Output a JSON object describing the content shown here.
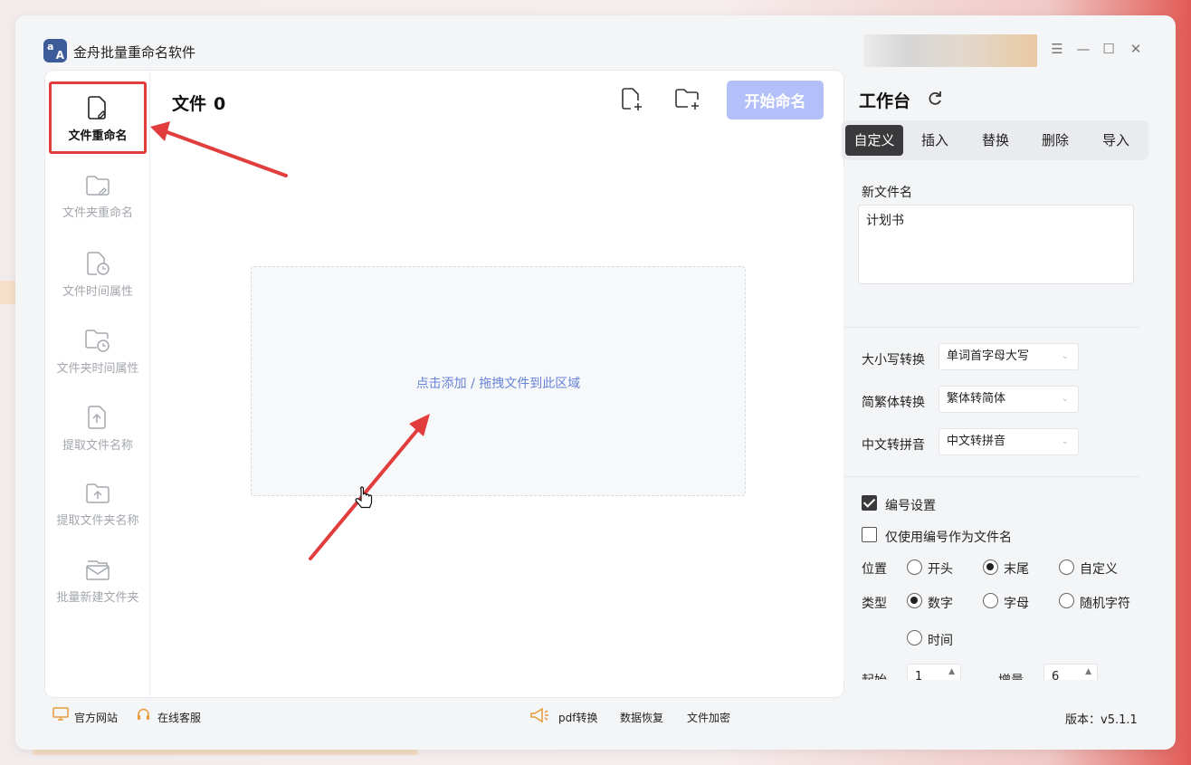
{
  "app": {
    "title": "金舟批量重命名软件",
    "logo_a": "a",
    "logo_b": "A"
  },
  "window_controls": {
    "menu": "☰",
    "minimize": "—",
    "maximize": "☐",
    "close": "✕"
  },
  "sidebar": {
    "items": [
      {
        "label": "文件重命名",
        "icon": "file-edit-icon"
      },
      {
        "label": "文件夹重命名",
        "icon": "folder-edit-icon"
      },
      {
        "label": "文件时间属性",
        "icon": "file-clock-icon"
      },
      {
        "label": "文件夹时间属性",
        "icon": "folder-clock-icon"
      },
      {
        "label": "提取文件名称",
        "icon": "file-upload-icon"
      },
      {
        "label": "提取文件夹名称",
        "icon": "folder-upload-icon"
      },
      {
        "label": "批量新建文件夹",
        "icon": "folder-mail-icon"
      }
    ]
  },
  "files": {
    "label": "文件",
    "count": "0"
  },
  "toolbar": {
    "start_label": "开始命名"
  },
  "dropzone": {
    "text": "点击添加 / 拖拽文件到此区域"
  },
  "workbench": {
    "title": "工作台",
    "tabs": [
      "自定义",
      "插入",
      "替换",
      "删除",
      "导入"
    ],
    "active_tab": "自定义",
    "new_name_label": "新文件名",
    "new_name_value": "计划书",
    "case_label": "大小写转换",
    "case_value": "单词首字母大写",
    "trad_label": "简繁体转换",
    "trad_value": "繁体转简体",
    "pinyin_label": "中文转拼音",
    "pinyin_value": "中文转拼音",
    "numbering_label": "编号设置",
    "numbering_checked": true,
    "only_number_label": "仅使用编号作为文件名",
    "only_number_checked": false,
    "position_label": "位置",
    "position_options": [
      "开头",
      "末尾",
      "自定义"
    ],
    "position_selected": "末尾",
    "type_label": "类型",
    "type_options": [
      "数字",
      "字母",
      "随机字符",
      "时间"
    ],
    "type_selected": "数字",
    "start_label": "起始",
    "start_value": "1",
    "step_label": "增量",
    "step_value": "6"
  },
  "footer": {
    "official_site": "官方网站",
    "online_service": "在线客服",
    "pdf": "pdf转换",
    "recovery": "数据恢复",
    "encrypt": "文件加密",
    "version": "版本：v5.1.1"
  },
  "colors": {
    "accent_red": "#e23d3d",
    "start_btn": "#b3bff8",
    "drop_text": "#6882d6",
    "dark_tab": "#3a3a3c"
  }
}
